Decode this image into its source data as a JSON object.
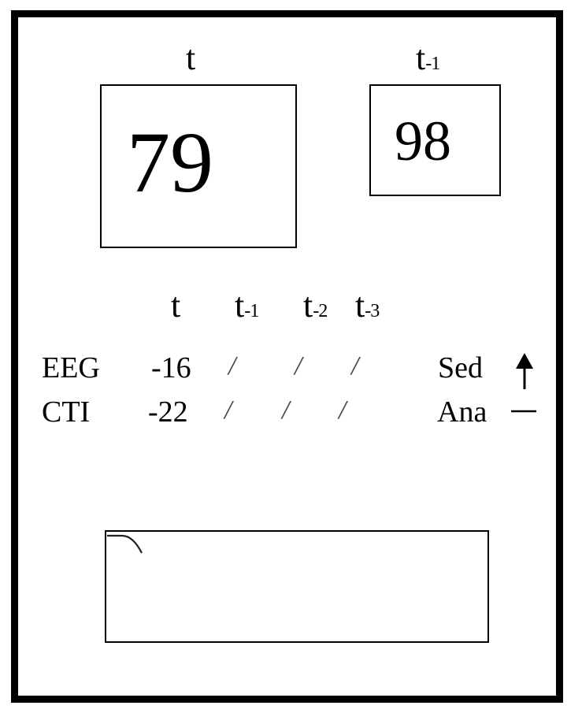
{
  "display": {
    "current": {
      "label": "t",
      "value": "79"
    },
    "previous": {
      "label": "t",
      "label_sub": "-1",
      "value": "98"
    }
  },
  "trend_table": {
    "columns": [
      {
        "label": "t",
        "sub": ""
      },
      {
        "label": "t",
        "sub": "-1"
      },
      {
        "label": "t",
        "sub": "-2"
      },
      {
        "label": "t",
        "sub": "-3"
      }
    ],
    "rows": [
      {
        "name": "EEG",
        "values": [
          "-16",
          "/",
          "/",
          "/"
        ],
        "indicator_label": "Sed",
        "indicator_icon": "arrow-up-icon",
        "indicator_symbol": "↑"
      },
      {
        "name": "CTI",
        "values": [
          "-22",
          "/",
          "/",
          "/"
        ],
        "indicator_label": "Ana",
        "indicator_icon": "dash-icon",
        "indicator_symbol": "—"
      }
    ]
  },
  "waveform_panel": {
    "icon": "waveform-curve-icon"
  }
}
